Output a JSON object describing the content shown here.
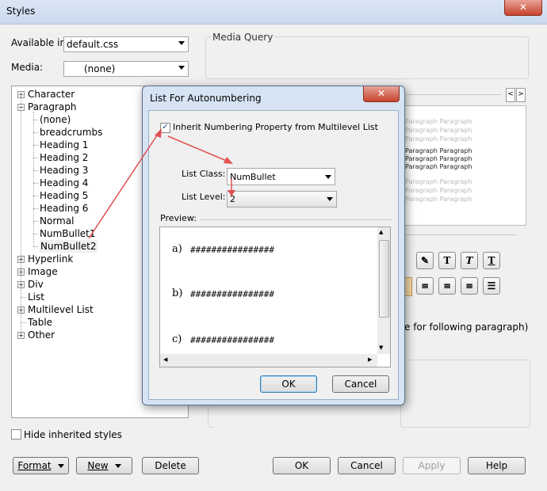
{
  "window": {
    "title": "Styles",
    "close_glyph": "✕"
  },
  "available_in": {
    "label": "Available in:",
    "value": "default.css"
  },
  "media": {
    "label": "Media:",
    "value": "(none)"
  },
  "media_query": {
    "title": "Media Query"
  },
  "tree": {
    "items": [
      {
        "label": "Character",
        "expandable": true
      },
      {
        "label": "Paragraph",
        "expandable": true,
        "expanded": true
      },
      {
        "label": "(none)"
      },
      {
        "label": "breadcrumbs"
      },
      {
        "label": "Heading 1"
      },
      {
        "label": "Heading 2"
      },
      {
        "label": "Heading 3"
      },
      {
        "label": "Heading 4"
      },
      {
        "label": "Heading 5"
      },
      {
        "label": "Heading 6"
      },
      {
        "label": "Normal"
      },
      {
        "label": "NumBullet1"
      },
      {
        "label": "NumBullet2",
        "selected": true
      },
      {
        "label": "Hyperlink",
        "expandable": true
      },
      {
        "label": "Image",
        "expandable": true
      },
      {
        "label": "Div",
        "expandable": true
      },
      {
        "label": "List"
      },
      {
        "label": "Multilevel List",
        "expandable": true
      },
      {
        "label": "Table"
      },
      {
        "label": "Other",
        "expandable": true
      }
    ]
  },
  "hide_inherited": {
    "label": "Hide inherited styles",
    "checked": false
  },
  "bottom_buttons": {
    "format": "Format",
    "new": "New",
    "delete": "Delete",
    "ok": "OK",
    "cancel": "Cancel",
    "apply": "Apply",
    "help": "Help"
  },
  "background_preview": {
    "text": "Paragraph Paragraph",
    "partial_label": "e for following paragraph)"
  },
  "dialog": {
    "title": "List For Autonumbering",
    "close_glyph": "✕",
    "inherit": {
      "label": "Inherit Numbering Property from Multilevel List",
      "checked": true
    },
    "list_class": {
      "label": "List Class:",
      "value": "NumBullet"
    },
    "list_level": {
      "label": "List Level:",
      "value": "2"
    },
    "preview": {
      "label": "Preview:",
      "items": [
        {
          "marker": "a)",
          "text": "################"
        },
        {
          "marker": "b)",
          "text": "################"
        },
        {
          "marker": "c)",
          "text": "################"
        }
      ]
    },
    "ok": "OK",
    "cancel": "Cancel"
  },
  "colors": {
    "annotation_arrow": "#e05050",
    "title_gradient": "#c9d9ed"
  }
}
